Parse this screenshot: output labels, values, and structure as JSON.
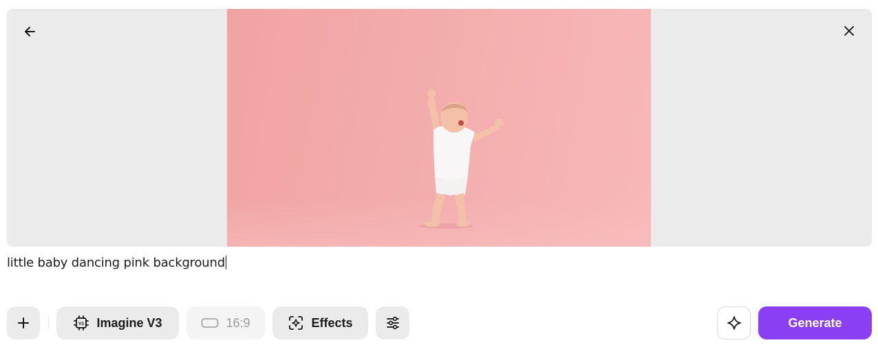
{
  "preview": {
    "back_icon": "arrow-left-icon",
    "close_icon": "close-icon",
    "image_subject": "baby-photo",
    "background_color": "#f3acac"
  },
  "prompt": {
    "text": "little baby dancing pink background"
  },
  "toolbar": {
    "add_icon": "plus-icon",
    "model_label": "Imagine V3",
    "model_icon": "chip-v3-icon",
    "ratio_label": "16:9",
    "ratio_icon": "aspect-ratio-icon",
    "effects_label": "Effects",
    "effects_icon": "effects-icon",
    "settings_icon": "sliders-icon",
    "magic_icon": "sparkle-icon",
    "generate_label": "Generate"
  },
  "colors": {
    "accent": "#8a3ff5",
    "button_bg": "#ebebeb",
    "panel_bg": "#ebebeb"
  }
}
